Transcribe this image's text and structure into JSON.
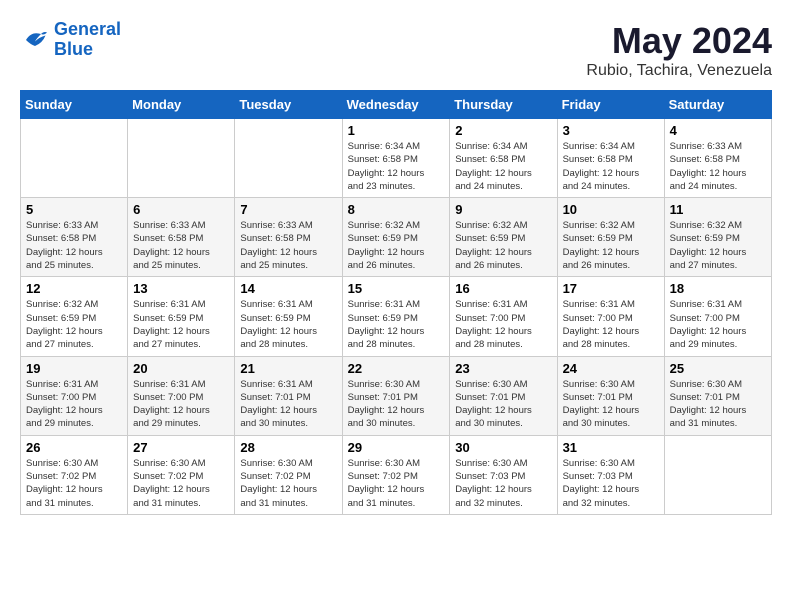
{
  "logo": {
    "line1": "General",
    "line2": "Blue"
  },
  "title": "May 2024",
  "subtitle": "Rubio, Tachira, Venezuela",
  "weekdays": [
    "Sunday",
    "Monday",
    "Tuesday",
    "Wednesday",
    "Thursday",
    "Friday",
    "Saturday"
  ],
  "weeks": [
    [
      {
        "day": "",
        "info": ""
      },
      {
        "day": "",
        "info": ""
      },
      {
        "day": "",
        "info": ""
      },
      {
        "day": "1",
        "info": "Sunrise: 6:34 AM\nSunset: 6:58 PM\nDaylight: 12 hours\nand 23 minutes."
      },
      {
        "day": "2",
        "info": "Sunrise: 6:34 AM\nSunset: 6:58 PM\nDaylight: 12 hours\nand 24 minutes."
      },
      {
        "day": "3",
        "info": "Sunrise: 6:34 AM\nSunset: 6:58 PM\nDaylight: 12 hours\nand 24 minutes."
      },
      {
        "day": "4",
        "info": "Sunrise: 6:33 AM\nSunset: 6:58 PM\nDaylight: 12 hours\nand 24 minutes."
      }
    ],
    [
      {
        "day": "5",
        "info": "Sunrise: 6:33 AM\nSunset: 6:58 PM\nDaylight: 12 hours\nand 25 minutes."
      },
      {
        "day": "6",
        "info": "Sunrise: 6:33 AM\nSunset: 6:58 PM\nDaylight: 12 hours\nand 25 minutes."
      },
      {
        "day": "7",
        "info": "Sunrise: 6:33 AM\nSunset: 6:58 PM\nDaylight: 12 hours\nand 25 minutes."
      },
      {
        "day": "8",
        "info": "Sunrise: 6:32 AM\nSunset: 6:59 PM\nDaylight: 12 hours\nand 26 minutes."
      },
      {
        "day": "9",
        "info": "Sunrise: 6:32 AM\nSunset: 6:59 PM\nDaylight: 12 hours\nand 26 minutes."
      },
      {
        "day": "10",
        "info": "Sunrise: 6:32 AM\nSunset: 6:59 PM\nDaylight: 12 hours\nand 26 minutes."
      },
      {
        "day": "11",
        "info": "Sunrise: 6:32 AM\nSunset: 6:59 PM\nDaylight: 12 hours\nand 27 minutes."
      }
    ],
    [
      {
        "day": "12",
        "info": "Sunrise: 6:32 AM\nSunset: 6:59 PM\nDaylight: 12 hours\nand 27 minutes."
      },
      {
        "day": "13",
        "info": "Sunrise: 6:31 AM\nSunset: 6:59 PM\nDaylight: 12 hours\nand 27 minutes."
      },
      {
        "day": "14",
        "info": "Sunrise: 6:31 AM\nSunset: 6:59 PM\nDaylight: 12 hours\nand 28 minutes."
      },
      {
        "day": "15",
        "info": "Sunrise: 6:31 AM\nSunset: 6:59 PM\nDaylight: 12 hours\nand 28 minutes."
      },
      {
        "day": "16",
        "info": "Sunrise: 6:31 AM\nSunset: 7:00 PM\nDaylight: 12 hours\nand 28 minutes."
      },
      {
        "day": "17",
        "info": "Sunrise: 6:31 AM\nSunset: 7:00 PM\nDaylight: 12 hours\nand 28 minutes."
      },
      {
        "day": "18",
        "info": "Sunrise: 6:31 AM\nSunset: 7:00 PM\nDaylight: 12 hours\nand 29 minutes."
      }
    ],
    [
      {
        "day": "19",
        "info": "Sunrise: 6:31 AM\nSunset: 7:00 PM\nDaylight: 12 hours\nand 29 minutes."
      },
      {
        "day": "20",
        "info": "Sunrise: 6:31 AM\nSunset: 7:00 PM\nDaylight: 12 hours\nand 29 minutes."
      },
      {
        "day": "21",
        "info": "Sunrise: 6:31 AM\nSunset: 7:01 PM\nDaylight: 12 hours\nand 30 minutes."
      },
      {
        "day": "22",
        "info": "Sunrise: 6:30 AM\nSunset: 7:01 PM\nDaylight: 12 hours\nand 30 minutes."
      },
      {
        "day": "23",
        "info": "Sunrise: 6:30 AM\nSunset: 7:01 PM\nDaylight: 12 hours\nand 30 minutes."
      },
      {
        "day": "24",
        "info": "Sunrise: 6:30 AM\nSunset: 7:01 PM\nDaylight: 12 hours\nand 30 minutes."
      },
      {
        "day": "25",
        "info": "Sunrise: 6:30 AM\nSunset: 7:01 PM\nDaylight: 12 hours\nand 31 minutes."
      }
    ],
    [
      {
        "day": "26",
        "info": "Sunrise: 6:30 AM\nSunset: 7:02 PM\nDaylight: 12 hours\nand 31 minutes."
      },
      {
        "day": "27",
        "info": "Sunrise: 6:30 AM\nSunset: 7:02 PM\nDaylight: 12 hours\nand 31 minutes."
      },
      {
        "day": "28",
        "info": "Sunrise: 6:30 AM\nSunset: 7:02 PM\nDaylight: 12 hours\nand 31 minutes."
      },
      {
        "day": "29",
        "info": "Sunrise: 6:30 AM\nSunset: 7:02 PM\nDaylight: 12 hours\nand 31 minutes."
      },
      {
        "day": "30",
        "info": "Sunrise: 6:30 AM\nSunset: 7:03 PM\nDaylight: 12 hours\nand 32 minutes."
      },
      {
        "day": "31",
        "info": "Sunrise: 6:30 AM\nSunset: 7:03 PM\nDaylight: 12 hours\nand 32 minutes."
      },
      {
        "day": "",
        "info": ""
      }
    ]
  ]
}
